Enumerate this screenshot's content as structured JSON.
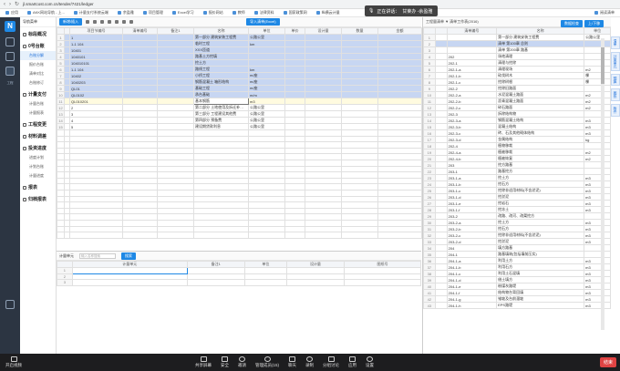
{
  "browser": {
    "url": "jl.smartcost.com.cn/tender/7421/ledger"
  },
  "bookmarks": [
    "应用",
    "AKK网站导航 - 上...",
    "计量支付系统云端",
    "余盈雅",
    "项目管理",
    "Excel学习",
    "报价网站",
    "教师",
    "法律资料",
    "国家政策网",
    "纵横云计量",
    "阅读清单"
  ],
  "meeting": {
    "speaking_label": "正在讲话：",
    "speaker": "甘莱办 -余盈雅"
  },
  "sidebar": {
    "logo": "N",
    "items": [
      "项目",
      "标段",
      "工程",
      "设置"
    ]
  },
  "nav": {
    "header": "导航菜单",
    "groups": [
      {
        "label": "标段概况",
        "items": []
      },
      {
        "label": "0号台账",
        "items": [
          "台账分解",
          "报价台账",
          "清单对比",
          "台账修订"
        ]
      },
      {
        "label": "计量支付",
        "items": [
          "计量台账",
          "计量报表"
        ]
      },
      {
        "label": "工程变更",
        "items": []
      },
      {
        "label": "材料调差",
        "items": []
      },
      {
        "label": "投资进度",
        "items": [
          "进度计划",
          "计划台账",
          "计量进度"
        ]
      },
      {
        "label": "报表",
        "items": []
      },
      {
        "label": "归档报表",
        "items": []
      }
    ]
  },
  "toolbar": {
    "add_label": "新增/插入",
    "import_label": "导入清单(Excel)"
  },
  "table": {
    "columns": [
      "",
      "",
      "项目节编号",
      "清单编号",
      "备注1",
      "名称",
      "单位",
      "单价",
      "设计量",
      "数量",
      "金额"
    ],
    "rows": [
      {
        "n": "1",
        "code": "1",
        "bill": "",
        "name": "第一部分 建筑安装工程费",
        "unit": "公路公里",
        "hl": true
      },
      {
        "n": "2",
        "code": "1-1 104",
        "bill": "",
        "name": "临时工程",
        "unit": "km",
        "hl": true
      },
      {
        "n": "3",
        "code": "10401",
        "bill": "",
        "name": "XXX匝道",
        "unit": "",
        "hl": true
      },
      {
        "n": "4",
        "code": "1040101",
        "bill": "",
        "name": "路基土方挖填",
        "unit": "",
        "hl": true
      },
      {
        "n": "5",
        "code": "104010101",
        "bill": "",
        "name": "挖土方",
        "unit": "",
        "hl": true
      },
      {
        "n": "6",
        "code": "1-1 104",
        "bill": "",
        "name": "路线工程",
        "unit": "km",
        "hl": true
      },
      {
        "n": "7",
        "code": "10402",
        "bill": "",
        "name": "小桥工程",
        "unit": "m/座",
        "hl": true
      },
      {
        "n": "8",
        "code": "1040203",
        "bill": "",
        "name": "钢筋混凝土 箱形结构",
        "unit": "m/座",
        "hl": true
      },
      {
        "n": "9",
        "code": "QL01",
        "bill": "",
        "name": "基础工程",
        "unit": "m/座",
        "hl": true
      },
      {
        "n": "10",
        "code": "QL0102",
        "bill": "",
        "name": "承台基础",
        "unit": "m/m",
        "hl": true
      },
      {
        "n": "11",
        "code": "QL010201",
        "bill": "",
        "name": "基本钢筋",
        "unit": "m3",
        "sel": true
      },
      {
        "n": "12",
        "code": "2",
        "bill": "",
        "name": "第二部分 土地使用及拆迁补偿费",
        "unit": "公路公里"
      },
      {
        "n": "13",
        "code": "3",
        "bill": "",
        "name": "第三部分 工程建设其他费",
        "unit": "公路公里"
      },
      {
        "n": "14",
        "code": "4",
        "bill": "",
        "name": "第四部分 预备费",
        "unit": "公路公里"
      },
      {
        "n": "15",
        "code": "5",
        "bill": "",
        "name": "建设期贷款利息",
        "unit": "公路公里"
      }
    ]
  },
  "bottom": {
    "label": "计量单元",
    "search_placeholder": "输入名称搜索",
    "search_btn": "搜索",
    "columns": [
      "",
      "计量单元",
      "备注1",
      "单位",
      "设计量",
      "图纸号"
    ],
    "rows": [
      "1",
      "2",
      "3"
    ]
  },
  "right": {
    "header": "工程量清单 ▼ 清单工作表(2016)",
    "columns": [
      "",
      "",
      "清单编号",
      "名称",
      "单位"
    ],
    "rows": [
      {
        "n": "1",
        "code": "",
        "name": "第一部分 建筑安装工程费",
        "unit": "公路公里"
      },
      {
        "n": "2",
        "code": "",
        "name": "清单 第100章 总则",
        "unit": ""
      },
      {
        "n": "3",
        "code": "",
        "name": "清单 第200章 路基",
        "unit": ""
      },
      {
        "n": "4",
        "code": "202",
        "name": "场地清理",
        "unit": ""
      },
      {
        "n": "5",
        "code": "202-1",
        "name": "清理与挖除",
        "unit": ""
      },
      {
        "n": "6",
        "code": "202-1-a",
        "name": "清理现场",
        "unit": "m2"
      },
      {
        "n": "7",
        "code": "202-1-b",
        "name": "砍伐树木",
        "unit": "棵"
      },
      {
        "n": "8",
        "code": "202-1-c",
        "name": "挖除树根",
        "unit": "棵"
      },
      {
        "n": "9",
        "code": "202-2",
        "name": "挖除旧路面",
        "unit": ""
      },
      {
        "n": "10",
        "code": "202-2-a",
        "name": "水泥混凝土路面",
        "unit": "m2"
      },
      {
        "n": "11",
        "code": "202-2-b",
        "name": "沥青混凝土路面",
        "unit": "m2"
      },
      {
        "n": "12",
        "code": "202-2-c",
        "name": "碎石路面",
        "unit": "m2"
      },
      {
        "n": "13",
        "code": "202-3",
        "name": "拆除结构物",
        "unit": ""
      },
      {
        "n": "14",
        "code": "202-3-a",
        "name": "钢筋混凝土结构",
        "unit": "m3"
      },
      {
        "n": "15",
        "code": "202-3-b",
        "name": "混凝土结构",
        "unit": "m3"
      },
      {
        "n": "16",
        "code": "202-3-c",
        "name": "砖、石及其他砌体结构",
        "unit": "m3"
      },
      {
        "n": "17",
        "code": "202-3-d",
        "name": "金属结构",
        "unit": "kg"
      },
      {
        "n": "18",
        "code": "202-4",
        "name": "植物移栽",
        "unit": ""
      },
      {
        "n": "19",
        "code": "202-4-a",
        "name": "植被移栽",
        "unit": "m2"
      },
      {
        "n": "20",
        "code": "202-4-b",
        "name": "植被恢复",
        "unit": "m2"
      },
      {
        "n": "21",
        "code": "203",
        "name": "挖方路基",
        "unit": ""
      },
      {
        "n": "22",
        "code": "203-1",
        "name": "路基挖方",
        "unit": ""
      },
      {
        "n": "23",
        "code": "203-1-a",
        "name": "挖土方",
        "unit": "m3"
      },
      {
        "n": "24",
        "code": "203-1-b",
        "name": "挖石方",
        "unit": "m3"
      },
      {
        "n": "25",
        "code": "203-1-c",
        "name": "挖除非适用材料(不含淤泥)",
        "unit": "m3"
      },
      {
        "n": "26",
        "code": "203-1-d",
        "name": "挖淤泥",
        "unit": "m3"
      },
      {
        "n": "27",
        "code": "203-1-e",
        "name": "挖岩石",
        "unit": "m3"
      },
      {
        "n": "28",
        "code": "203-1-f",
        "name": "挖冻土",
        "unit": "m3"
      },
      {
        "n": "29",
        "code": "203-2",
        "name": "改路、改河、改渠挖方",
        "unit": ""
      },
      {
        "n": "30",
        "code": "203-2-a",
        "name": "挖土方",
        "unit": "m3"
      },
      {
        "n": "31",
        "code": "203-2-b",
        "name": "挖石方",
        "unit": "m3"
      },
      {
        "n": "32",
        "code": "203-2-c",
        "name": "挖除非适用材料(不含淤泥)",
        "unit": "m3"
      },
      {
        "n": "33",
        "code": "203-2-d",
        "name": "挖淤泥",
        "unit": "m3"
      },
      {
        "n": "34",
        "code": "204",
        "name": "填方路基",
        "unit": ""
      },
      {
        "n": "35",
        "code": "204-1",
        "name": "路基填筑(包括填前压实)",
        "unit": ""
      },
      {
        "n": "36",
        "code": "204-1-a",
        "name": "利用土方",
        "unit": "m3"
      },
      {
        "n": "37",
        "code": "204-1-b",
        "name": "利用石方",
        "unit": "m3"
      },
      {
        "n": "38",
        "code": "204-1-c",
        "name": "利用土石混填",
        "unit": "m3"
      },
      {
        "n": "39",
        "code": "204-1-d",
        "name": "借土填方",
        "unit": "m3"
      },
      {
        "n": "40",
        "code": "204-1-e",
        "name": "粉煤灰路堤",
        "unit": "m3"
      },
      {
        "n": "41",
        "code": "204-1-f",
        "name": "结构物台背回填",
        "unit": "m3"
      },
      {
        "n": "42",
        "code": "204-1-g",
        "name": "锥坡及台前溜坡",
        "unit": "m3"
      },
      {
        "n": "43",
        "code": "204-1-h",
        "name": "EPS路堤",
        "unit": "m3"
      }
    ]
  },
  "top_buttons": [
    "数据检查",
    "上/下移"
  ],
  "side_tabs": [
    "清单",
    "计量单元",
    "预算",
    "图纸",
    "附件"
  ],
  "zoom": {
    "left": [
      "开启视频"
    ],
    "items": [
      "共享屏幕",
      "安全",
      "邀请",
      "管理成员(15)",
      "聊天",
      "录制",
      "分组讨论",
      "应用",
      "设置"
    ],
    "end": "结束"
  }
}
